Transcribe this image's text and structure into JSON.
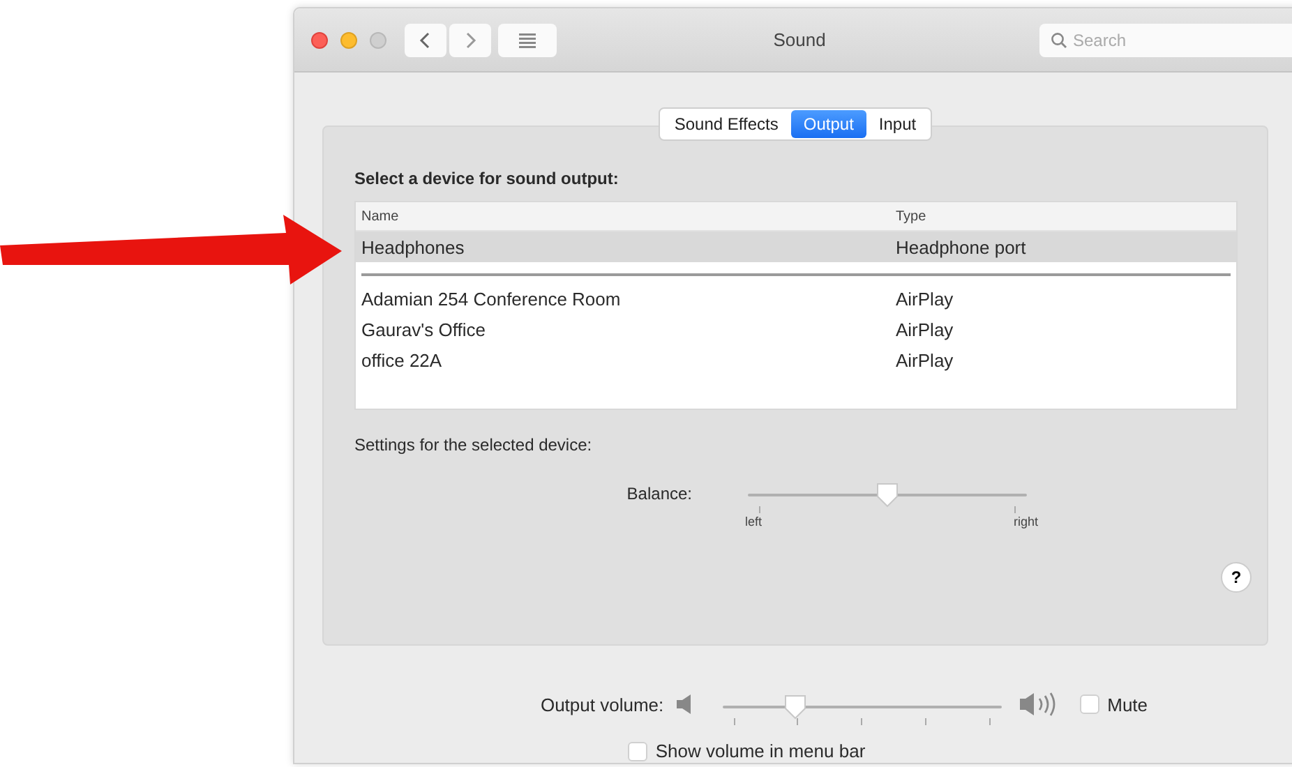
{
  "window": {
    "title": "Sound",
    "search": {
      "placeholder": "Search"
    }
  },
  "tabs": [
    {
      "label": "Sound Effects",
      "selected": false
    },
    {
      "label": "Output",
      "selected": true
    },
    {
      "label": "Input",
      "selected": false
    }
  ],
  "device_heading": "Select a device for sound output:",
  "table": {
    "columns": [
      "Name",
      "Type"
    ],
    "groups": [
      [
        {
          "name": "Headphones",
          "type": "Headphone port",
          "selected": true
        }
      ],
      [
        {
          "name": "Adamian 254 Conference Room",
          "type": "AirPlay",
          "selected": false
        },
        {
          "name": "Gaurav's Office",
          "type": "AirPlay",
          "selected": false
        },
        {
          "name": "office 22A",
          "type": "AirPlay",
          "selected": false
        }
      ]
    ]
  },
  "settings_heading": "Settings for the selected device:",
  "balance": {
    "label": "Balance:",
    "level": 0.5,
    "min_label": "left",
    "max_label": "right"
  },
  "help": "?",
  "output_volume": {
    "label": "Output volume:",
    "level": 0.26
  },
  "mute": {
    "label": "Mute",
    "checked": false
  },
  "show_in_menu_bar": {
    "label": "Show volume in menu bar",
    "checked": false
  }
}
